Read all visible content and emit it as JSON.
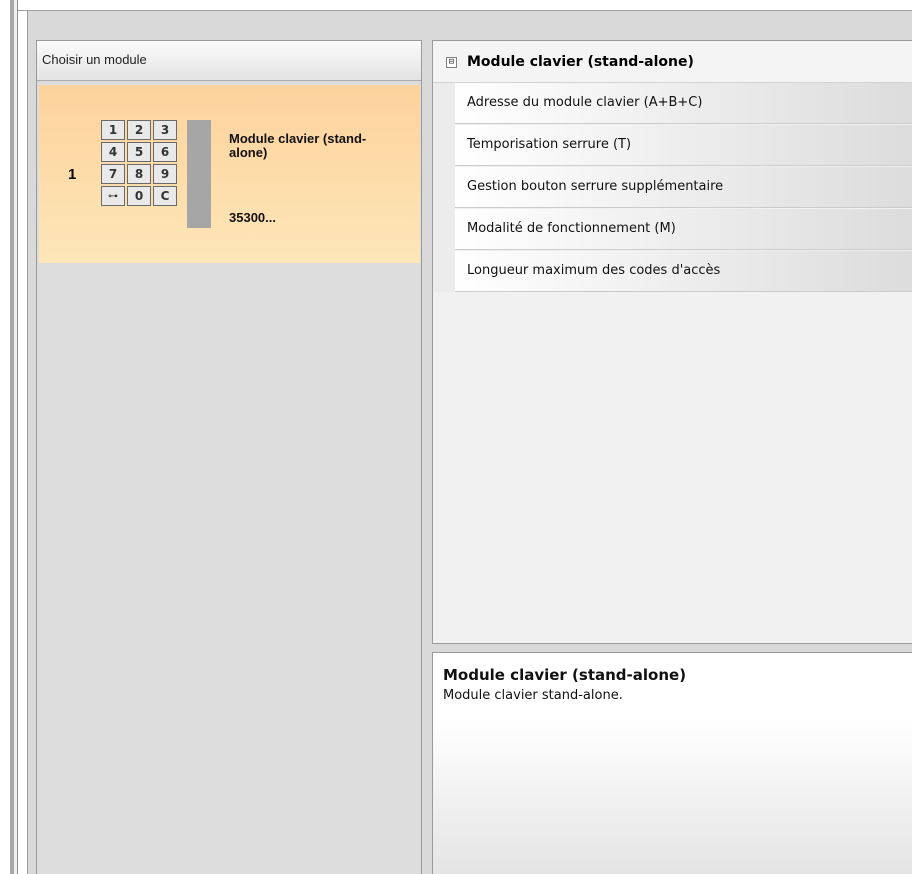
{
  "left_panel": {
    "header": "Choisir un module",
    "module": {
      "index": "1",
      "name": "Module clavier (stand-alone)",
      "code": "35300...",
      "keypad_keys": [
        "1",
        "2",
        "3",
        "4",
        "5",
        "6",
        "7",
        "8",
        "9",
        "⊶",
        "0",
        "C"
      ]
    }
  },
  "property_grid": {
    "category": "Module clavier (stand-alone)",
    "collapse_glyph": "⊟",
    "items": [
      "Adresse du module clavier (A+B+C)",
      "Temporisation serrure (T)",
      "Gestion bouton serrure supplémentaire",
      "Modalité de fonctionnement (M)",
      "Longueur maximum des codes d'accès"
    ]
  },
  "description": {
    "title": "Module clavier (stand-alone)",
    "text": "Module clavier stand-alone."
  }
}
